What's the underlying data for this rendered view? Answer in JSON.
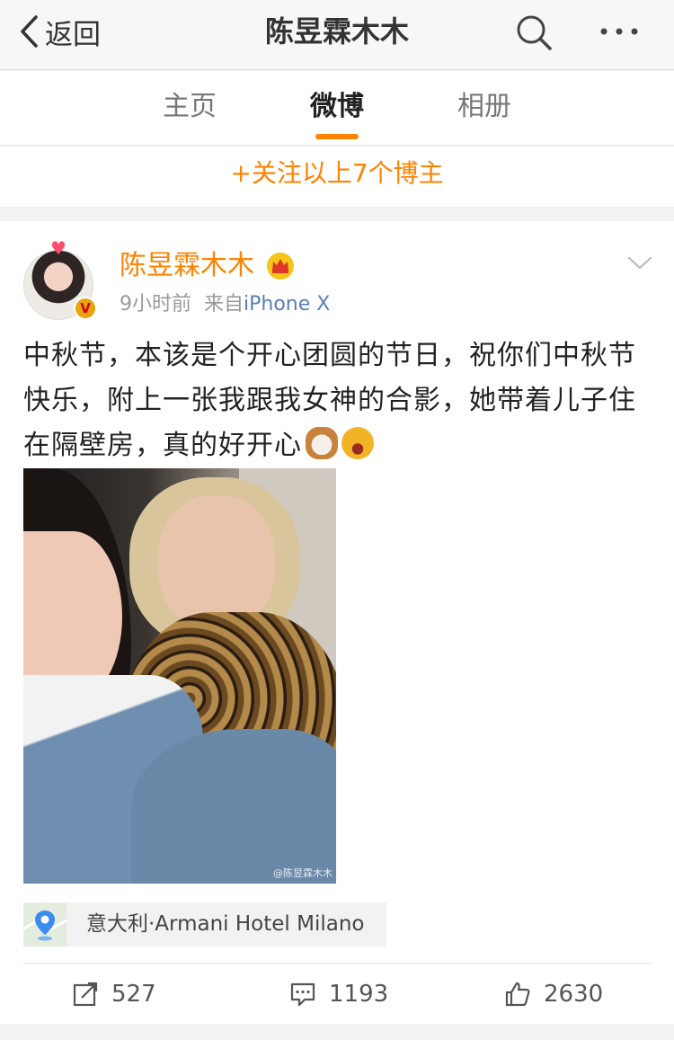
{
  "navbar": {
    "back_label": "返回",
    "title": "陈昱霖木木"
  },
  "tabs": [
    {
      "label": "主页",
      "active": false
    },
    {
      "label": "微博",
      "active": true
    },
    {
      "label": "相册",
      "active": false
    }
  ],
  "follow_bar": {
    "label": "+关注以上7个博主"
  },
  "post": {
    "author": "陈昱霖木木",
    "verified": true,
    "time": "9小时前",
    "source_prefix": "来自",
    "source": "iPhone X",
    "text": "中秋节，本该是个开心团圆的节日，祝你们中秋节快乐，附上一张我跟我女神的合影，她带着儿子住在隔壁房，真的好开心",
    "emojis": [
      "cat-emoji-icon",
      "laugh-emoji-icon"
    ],
    "photo_watermark": "@陈昱霖木木",
    "location": "意大利·Armani Hotel Milano",
    "actions": {
      "repost_count": "527",
      "comment_count": "1193",
      "like_count": "2630"
    }
  },
  "colors": {
    "accent": "#ff8200",
    "link": "#5b7fb3"
  }
}
